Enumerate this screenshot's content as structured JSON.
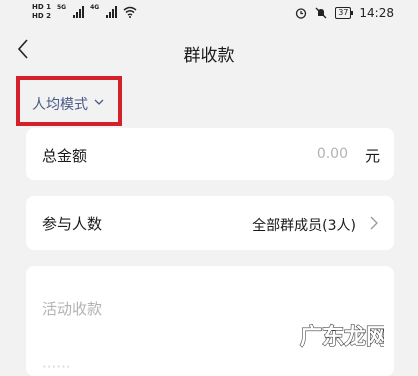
{
  "status_bar": {
    "sim1": "HD 1",
    "sim2": "HD 2",
    "network1": "5G",
    "network2": "4G",
    "battery": "37",
    "time": "14:28"
  },
  "header": {
    "title": "群收款"
  },
  "mode_selector": {
    "label": "人均模式"
  },
  "total_row": {
    "label": "总金额",
    "value": "0.00",
    "unit": "元"
  },
  "members_row": {
    "label": "参与人数",
    "value": "全部群成员(3人)"
  },
  "description": {
    "placeholder": "活动收款"
  },
  "watermark": {
    "text": "广东龙网"
  },
  "colors": {
    "highlight_border": "#d4202a",
    "mode_text": "#4a5a86",
    "placeholder": "#b3b3b3",
    "background": "#f2f2f2"
  }
}
